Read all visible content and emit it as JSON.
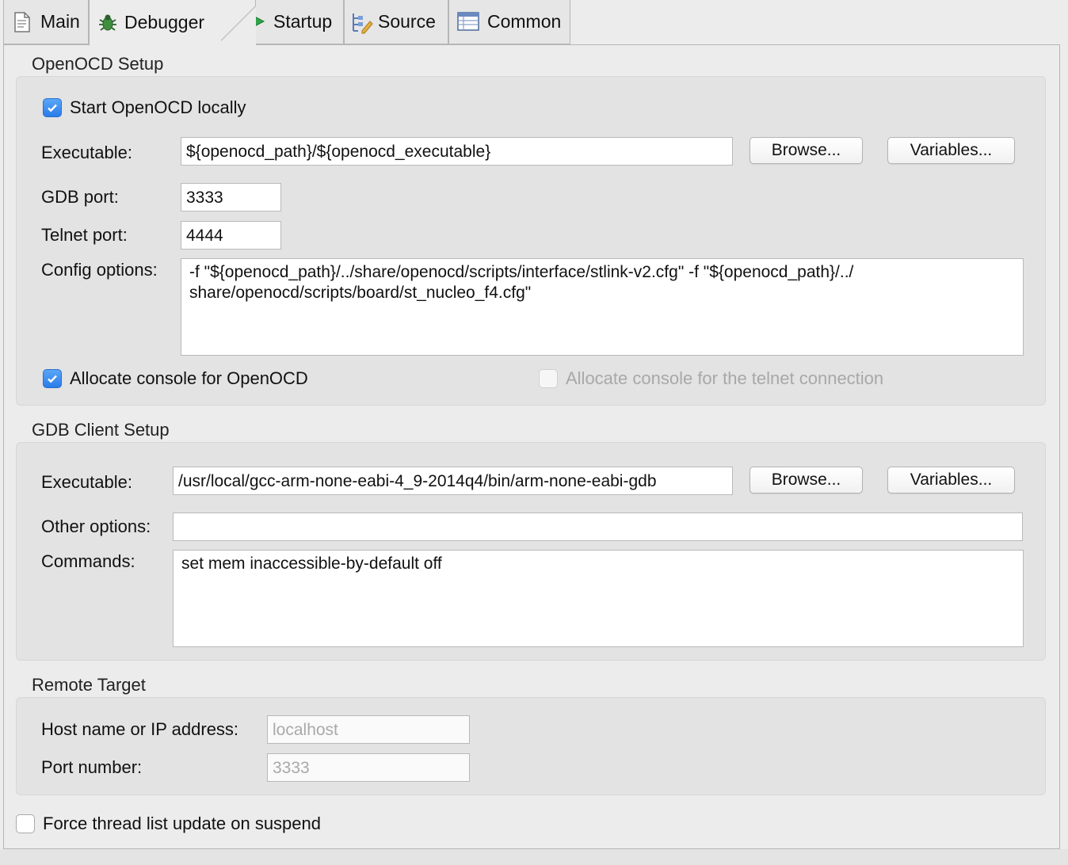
{
  "tabs": [
    {
      "label": "Main",
      "icon": "document-icon"
    },
    {
      "label": "Debugger",
      "icon": "bug-icon"
    },
    {
      "label": "Startup",
      "icon": "play-icon"
    },
    {
      "label": "Source",
      "icon": "source-icon"
    },
    {
      "label": "Common",
      "icon": "table-icon"
    }
  ],
  "active_tab": "Debugger",
  "openocd": {
    "title": "OpenOCD Setup",
    "start_locally": {
      "label": "Start OpenOCD locally",
      "checked": true
    },
    "executable_label": "Executable:",
    "executable_value": "${openocd_path}/${openocd_executable}",
    "browse": "Browse...",
    "variables": "Variables...",
    "gdb_port_label": "GDB port:",
    "gdb_port_value": "3333",
    "telnet_port_label": "Telnet port:",
    "telnet_port_value": "4444",
    "config_label": "Config options:",
    "config_value": "-f \"${openocd_path}/../share/openocd/scripts/interface/stlink-v2.cfg\" -f \"${openocd_path}/../\nshare/openocd/scripts/board/st_nucleo_f4.cfg\"",
    "alloc_console": {
      "label": "Allocate console for OpenOCD",
      "checked": true
    },
    "alloc_telnet": {
      "label": "Allocate console for the telnet connection",
      "checked": false,
      "enabled": false
    }
  },
  "gdb": {
    "title": "GDB Client Setup",
    "executable_label": "Executable:",
    "executable_value": "/usr/local/gcc-arm-none-eabi-4_9-2014q4/bin/arm-none-eabi-gdb",
    "browse": "Browse...",
    "variables": "Variables...",
    "other_label": "Other options:",
    "other_value": "",
    "commands_label": "Commands:",
    "commands_value": "set mem inaccessible-by-default off"
  },
  "remote": {
    "title": "Remote Target",
    "host_label": "Host name or IP address:",
    "host_value": "localhost",
    "port_label": "Port number:",
    "port_value": "3333"
  },
  "force_thread": {
    "label": "Force thread list update on suspend",
    "checked": false
  },
  "colors": {
    "checkbox_accent": "#2a7ce8",
    "disabled_text": "#a8a8a8"
  }
}
